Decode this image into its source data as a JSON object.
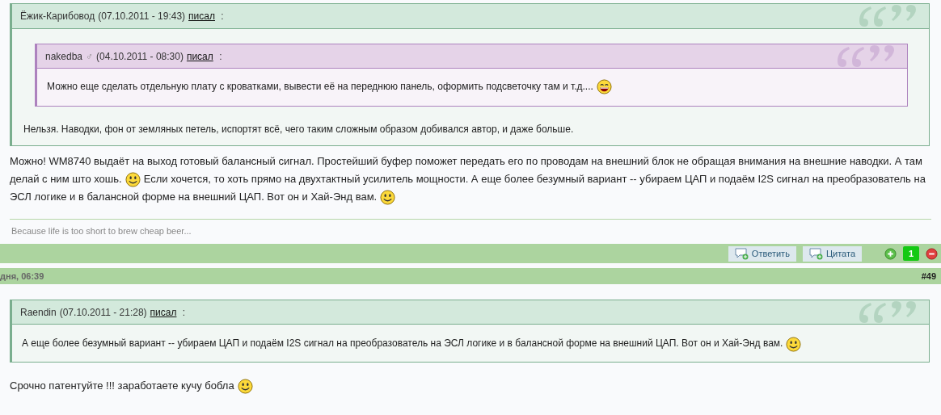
{
  "post_top": {
    "quote": {
      "author": "Ёжик-Карибовод",
      "date": "(07.10.2011 - 19:43)",
      "link": "писал",
      "colon": ":",
      "color": "#7aae8e",
      "nested": {
        "author": "nakedba",
        "gender": "♂",
        "date": "(04.10.2011 - 08:30)",
        "link": "писал",
        "colon": ":",
        "color": "#ad82be",
        "segments": [
          {
            "kind": "text",
            "text": "Можно еще сделать отдельную плату с кроватками, вывести её на переднюю панель, оформить подсветочку там и т.д...."
          },
          {
            "kind": "grin"
          }
        ]
      },
      "segments": [
        {
          "kind": "text",
          "text": "Нельзя. Наводки, фон от земляных петель, испортят всё, чего таким сложным образом добивался автор, и даже больше."
        }
      ]
    },
    "lines": [
      [
        {
          "kind": "text",
          "text": "Можно! WM8740 выдаёт на выход готовый балансный сигнал. Простейший буфер поможет передать его по проводам на внешний блок не обращая внимания на внешние наводки. А там"
        }
      ],
      [
        {
          "kind": "text",
          "text": "делай с ним што хошь."
        },
        {
          "kind": "smile"
        },
        {
          "kind": "text",
          "text": "Если хочется, то хоть прямо на двухтактный усилитель мощности. А еще более безумный вариант -- убираем ЦАП и подаём I2S сигнал на преобразователь на"
        }
      ],
      [
        {
          "kind": "text",
          "text": "ЭСЛ логике и в балансной форме на внешний ЦАП. Вот он и Хай-Энд вам."
        },
        {
          "kind": "smile"
        }
      ]
    ],
    "signature": "Because life is too short to brew cheap beer...",
    "actions": [
      {
        "label": "Ответить"
      },
      {
        "label": "Цитата"
      }
    ],
    "rating": "1"
  },
  "post_next": {
    "date": "дня, 06:39",
    "number": "#49",
    "quote": {
      "author": "Raendin",
      "date": "(07.10.2011 - 21:28)",
      "link": "писал",
      "colon": ":",
      "color": "#7aae8e",
      "segments": [
        {
          "kind": "text",
          "text": "А еще более безумный вариант -- убираем ЦАП и подаём I2S сигнал на преобразователь на ЭСЛ логике и в балансной форме на внешний ЦАП. Вот он и Хай-Энд вам."
        },
        {
          "kind": "smile"
        }
      ]
    },
    "segments": [
      {
        "kind": "text",
        "text": "Срочно патентуйте !!! заработаете кучу бобла"
      },
      {
        "kind": "smile"
      }
    ]
  }
}
